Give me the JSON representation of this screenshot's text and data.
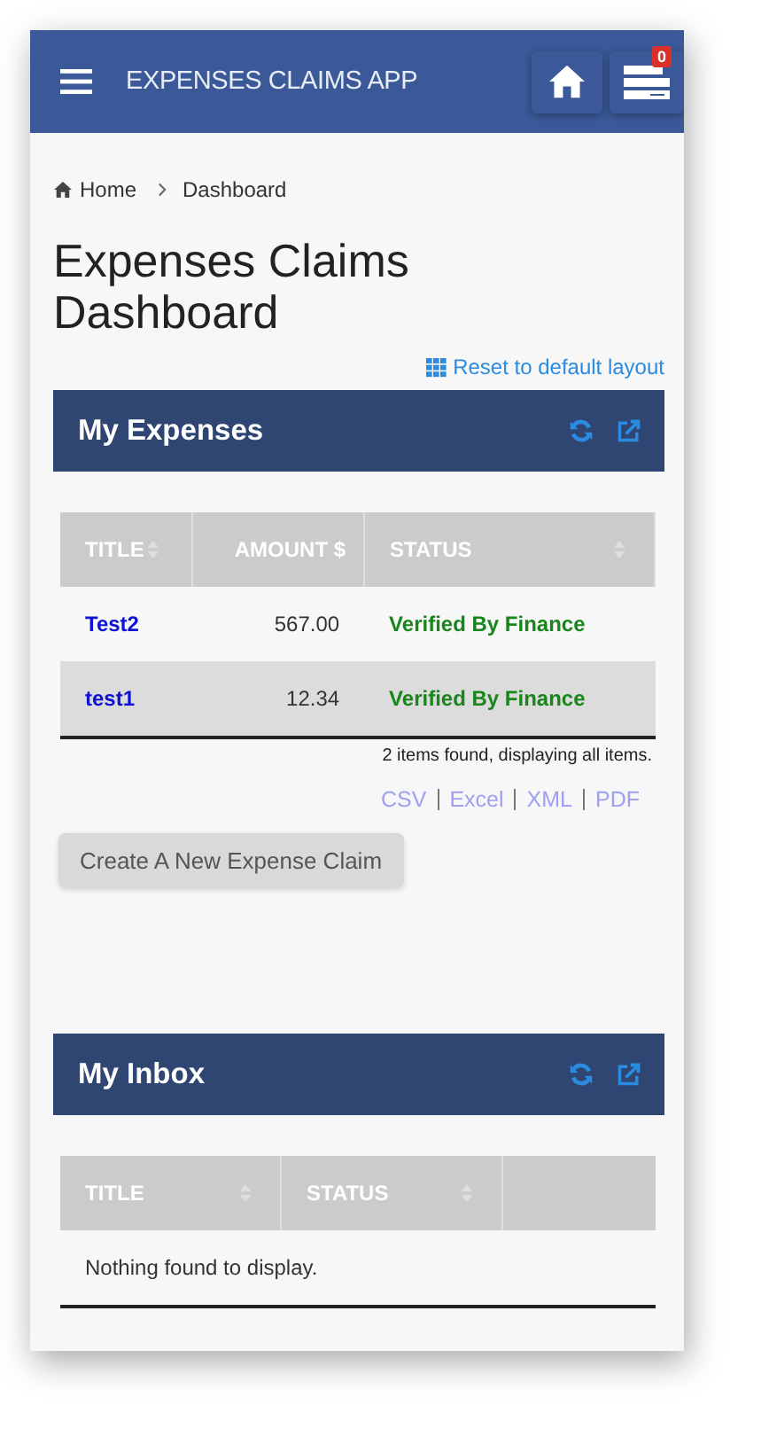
{
  "app_bar": {
    "title": "EXPENSES CLAIMS APP",
    "notification_count": "0"
  },
  "breadcrumb": [
    "Home",
    "Dashboard"
  ],
  "page_title": "Expenses Claims Dashboard",
  "reset_link": "Reset to default layout",
  "panels": [
    {
      "title": "My Expenses",
      "columns": [
        {
          "label": "TITLE",
          "sortable": true,
          "kind": "text"
        },
        {
          "label": "AMOUNT $",
          "sortable": false,
          "kind": "amount"
        },
        {
          "label": "STATUS",
          "sortable": true,
          "kind": "text"
        }
      ],
      "rows": [
        [
          "Test2",
          "567.00",
          "Verified By Finance"
        ],
        [
          "test1",
          "12.34",
          "Verified By Finance"
        ]
      ],
      "summary": "2 items found, displaying all items.",
      "exports": [
        "CSV",
        "Excel",
        "XML",
        "PDF"
      ],
      "button": "Create A New Expense Claim"
    },
    {
      "title": "My Inbox",
      "columns": [
        {
          "label": "TITLE",
          "sortable": true,
          "kind": "text"
        },
        {
          "label": "STATUS",
          "sortable": true,
          "kind": "text"
        }
      ],
      "empty_message": "Nothing found to display."
    }
  ]
}
